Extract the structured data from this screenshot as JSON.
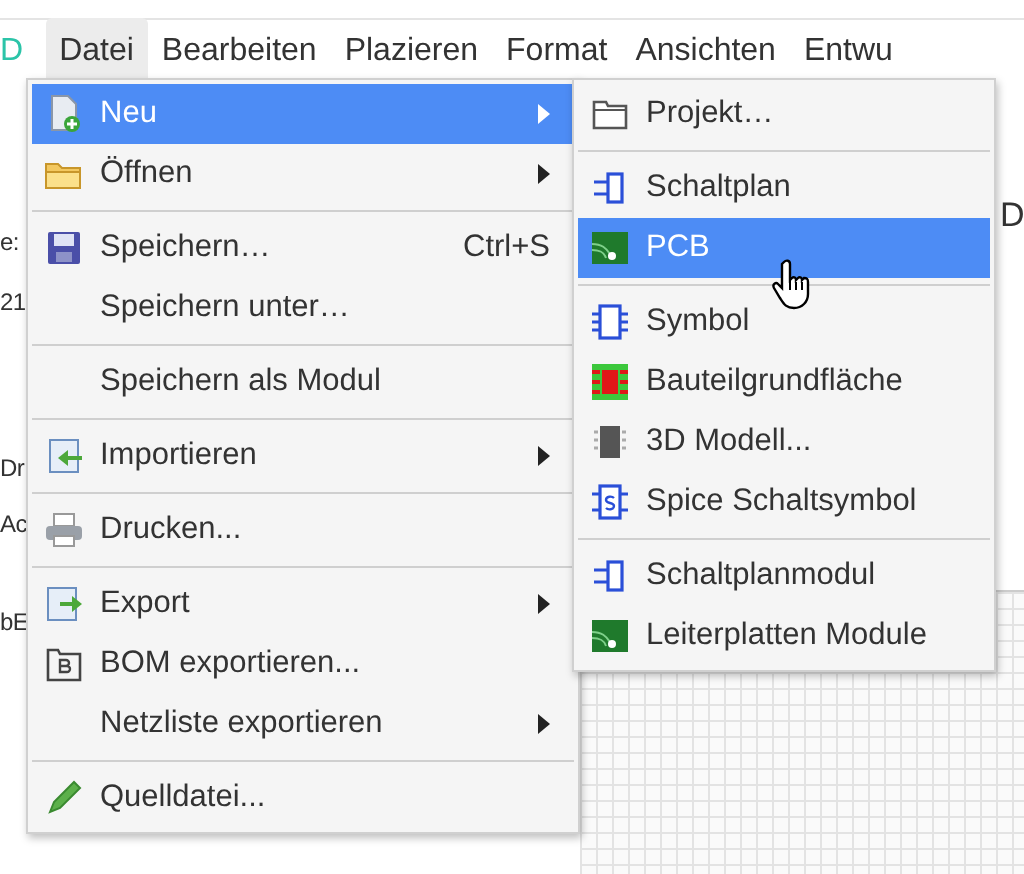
{
  "menubar": [
    {
      "label": "D",
      "selected": false
    },
    {
      "label": "Datei",
      "selected": true
    },
    {
      "label": "Bearbeiten",
      "selected": false
    },
    {
      "label": "Plazieren",
      "selected": false
    },
    {
      "label": "Format",
      "selected": false
    },
    {
      "label": "Ansichten",
      "selected": false
    },
    {
      "label": "Entwu",
      "selected": false
    }
  ],
  "background_fragments": [
    "e:",
    "21",
    "Dr",
    "Ac",
    "bE"
  ],
  "right_fragment": "D",
  "file_menu": [
    {
      "kind": "item",
      "label": "Neu",
      "has_submenu": true,
      "selected": true
    },
    {
      "kind": "item",
      "label": "Öffnen",
      "has_submenu": true,
      "selected": false
    },
    {
      "kind": "separator"
    },
    {
      "kind": "item",
      "label": "Speichern…",
      "shortcut": "Ctrl+S",
      "has_submenu": false,
      "selected": false
    },
    {
      "kind": "item",
      "label": "Speichern unter…",
      "has_submenu": false,
      "selected": false
    },
    {
      "kind": "separator"
    },
    {
      "kind": "item",
      "label": "Speichern als Modul",
      "has_submenu": false,
      "selected": false
    },
    {
      "kind": "separator"
    },
    {
      "kind": "item",
      "label": "Importieren",
      "has_submenu": true,
      "selected": false
    },
    {
      "kind": "separator"
    },
    {
      "kind": "item",
      "label": "Drucken...",
      "has_submenu": false,
      "selected": false
    },
    {
      "kind": "separator"
    },
    {
      "kind": "item",
      "label": "Export",
      "has_submenu": true,
      "selected": false
    },
    {
      "kind": "item",
      "label": "BOM exportieren...",
      "has_submenu": false,
      "selected": false
    },
    {
      "kind": "item",
      "label": "Netzliste exportieren",
      "has_submenu": true,
      "selected": false
    },
    {
      "kind": "separator"
    },
    {
      "kind": "item",
      "label": "Quelldatei...",
      "has_submenu": false,
      "selected": false
    }
  ],
  "new_submenu": [
    {
      "kind": "item",
      "label": "Projekt…",
      "selected": false
    },
    {
      "kind": "separator"
    },
    {
      "kind": "item",
      "label": "Schaltplan",
      "selected": false
    },
    {
      "kind": "item",
      "label": "PCB",
      "selected": true
    },
    {
      "kind": "separator"
    },
    {
      "kind": "item",
      "label": "Symbol",
      "selected": false
    },
    {
      "kind": "item",
      "label": "Bauteilgrundfläche",
      "selected": false
    },
    {
      "kind": "item",
      "label": "3D Modell...",
      "selected": false
    },
    {
      "kind": "item",
      "label": "Spice Schaltsymbol",
      "selected": false
    },
    {
      "kind": "separator"
    },
    {
      "kind": "item",
      "label": "Schaltplanmodul",
      "selected": false
    },
    {
      "kind": "item",
      "label": "Leiterplatten Module",
      "selected": false
    }
  ]
}
